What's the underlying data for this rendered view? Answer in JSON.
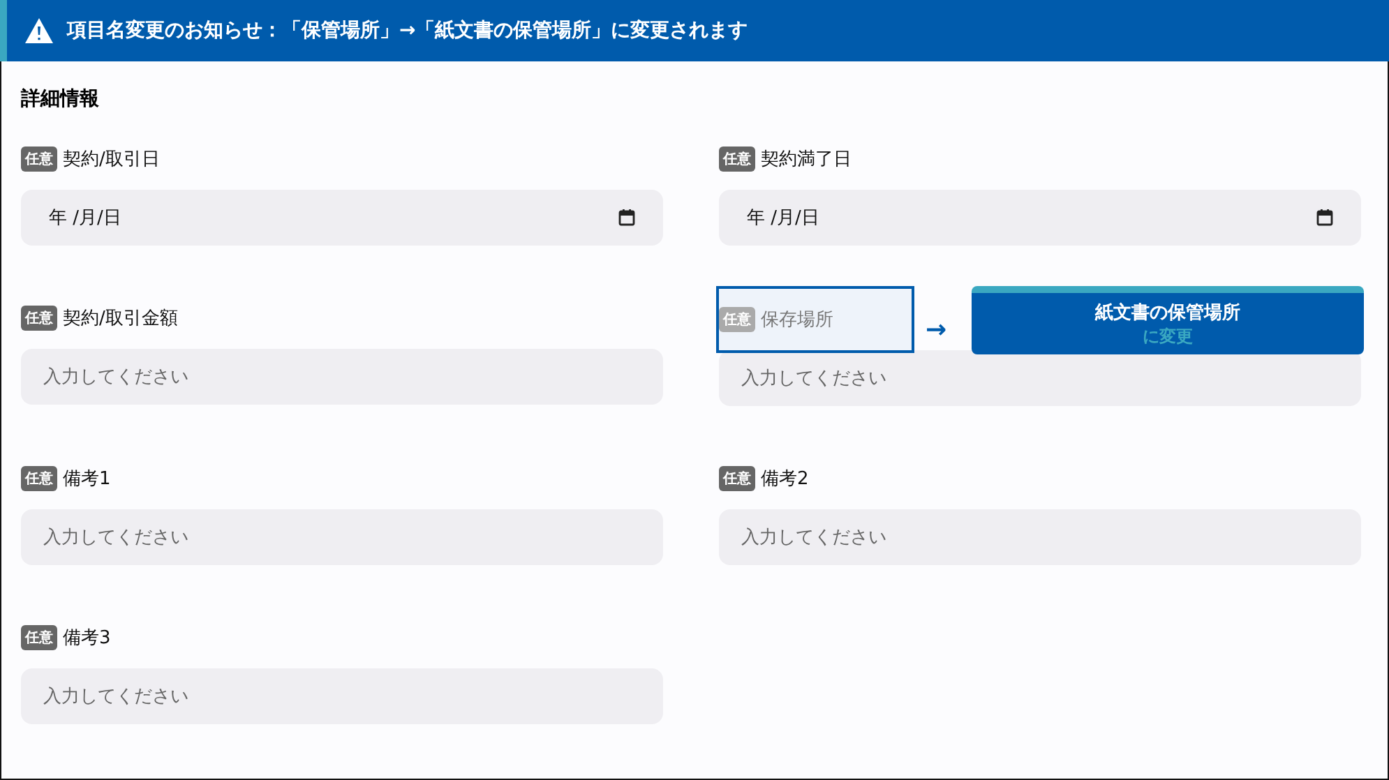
{
  "banner": {
    "text": "項目名変更のお知らせ：「保管場所」→「紙文書の保管場所」に変更されます"
  },
  "section_title": "詳細情報",
  "fields": [
    {
      "badge": "任意",
      "label": "契約/取引日",
      "kind": "date",
      "value": "年 /月/日",
      "highlighted": false
    },
    {
      "badge": "任意",
      "label": "契約満了日",
      "kind": "date",
      "value": "年 /月/日",
      "highlighted": false
    },
    {
      "badge": "任意",
      "label": "契約/取引金額",
      "kind": "text",
      "placeholder": "入力してください",
      "highlighted": false
    },
    {
      "badge": "任意",
      "label": "保存場所",
      "kind": "text",
      "placeholder": "入力してください",
      "highlighted": true,
      "callout": {
        "arrow": "→",
        "title": "紙文書の保管場所",
        "subtitle": "に変更"
      }
    },
    {
      "badge": "任意",
      "label": "備考1",
      "kind": "text",
      "placeholder": "入力してください",
      "highlighted": false
    },
    {
      "badge": "任意",
      "label": "備考2",
      "kind": "text",
      "placeholder": "入力してください",
      "highlighted": false
    },
    {
      "badge": "任意",
      "label": "備考3",
      "kind": "text",
      "placeholder": "入力してください",
      "highlighted": false
    }
  ]
}
